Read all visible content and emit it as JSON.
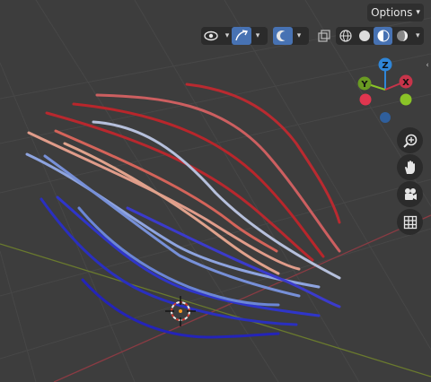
{
  "header": {
    "options_label": "Options"
  },
  "toolbar": {
    "visibility_icon": "eye-selectability-icon",
    "gizmo_icon": "gizmo-icon",
    "overlays_icon": "overlays-icon",
    "xray_icon": "xray-toggle-icon",
    "shading_modes": [
      "wireframe-shading-icon",
      "solid-shading-icon",
      "material-preview-icon",
      "rendered-shading-icon"
    ],
    "active_shading": "material-preview-icon"
  },
  "navigation_gizmo": {
    "z_label": "Z",
    "y_label": "Y",
    "x_label": "X",
    "colors": {
      "x": "#c7344a",
      "y": "#8ac427",
      "z": "#2f86d8"
    }
  },
  "nav_buttons": [
    "zoom-icon",
    "hand-pan-icon",
    "camera-icon",
    "grid-ortho-icon"
  ],
  "scene": {
    "object": "hair-curves",
    "color_gradient": [
      "#1f1fc7",
      "#6f8ee0",
      "#b9c6e6",
      "#e08a76",
      "#b82428"
    ]
  }
}
